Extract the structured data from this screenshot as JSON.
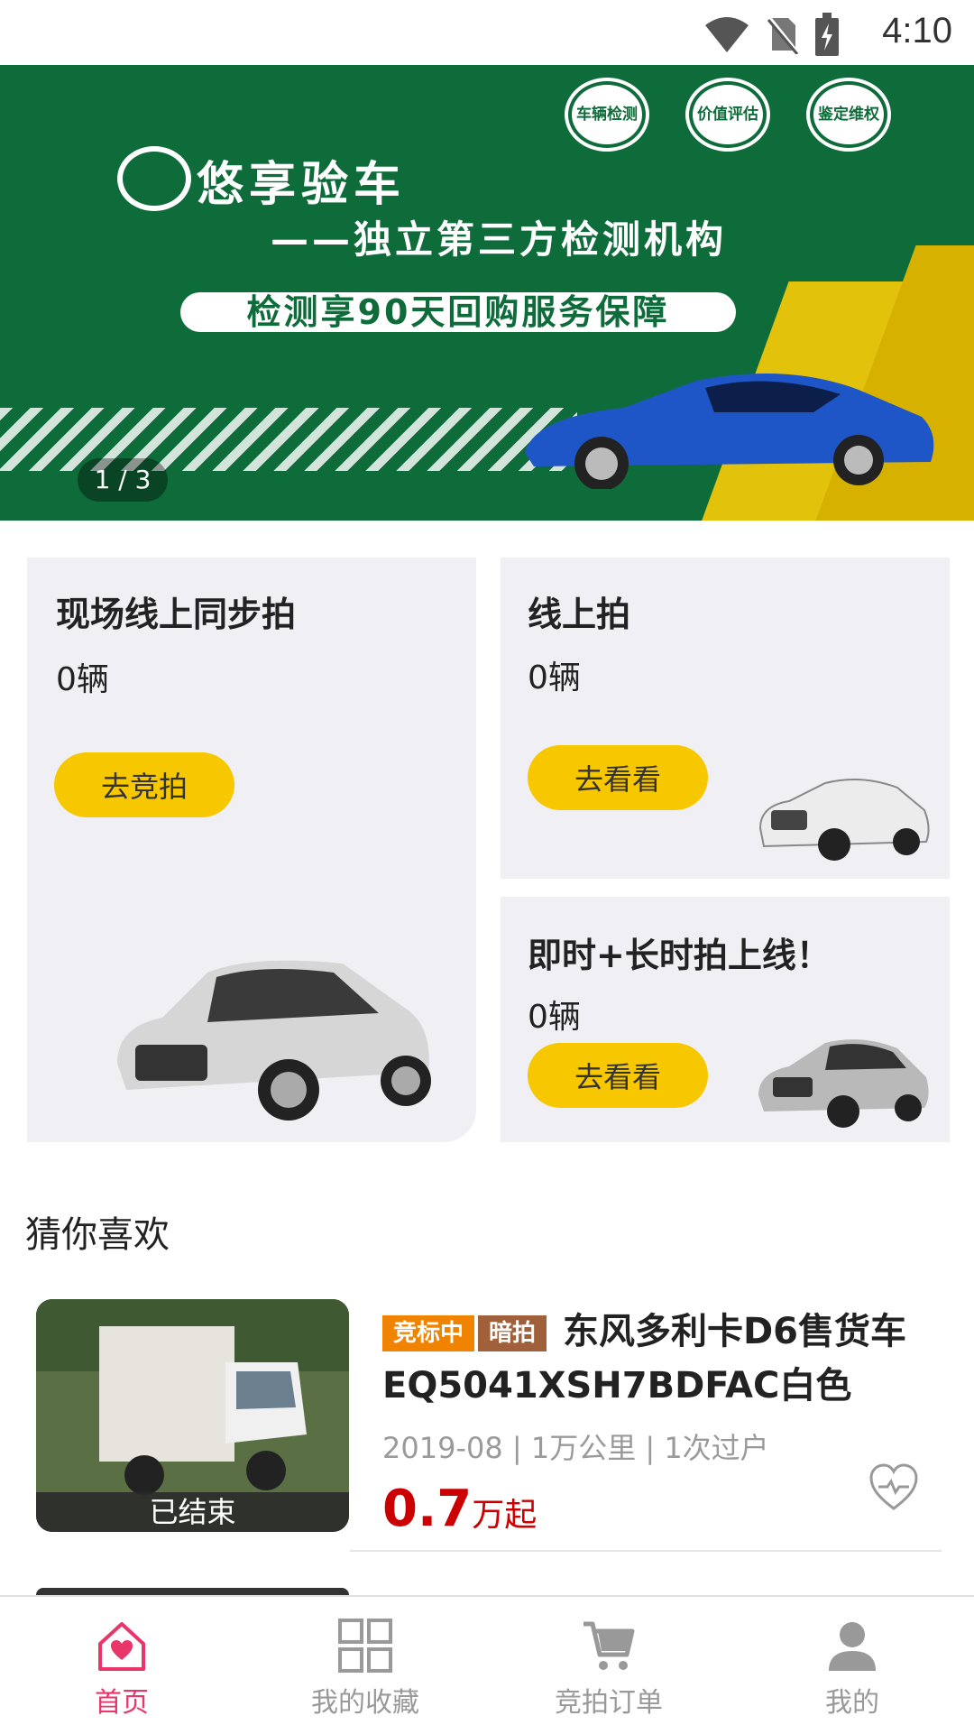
{
  "status_bar": {
    "time": "4:10",
    "icons": [
      "wifi-icon",
      "no-sim-icon",
      "battery-charging-icon"
    ]
  },
  "banner": {
    "logo_text": "悠享验车",
    "subtitle": "——独立第三方检测机构",
    "pill": "检测享90天回购服务保障",
    "badges": [
      "车辆检测",
      "价值评估",
      "鉴定维权"
    ],
    "indicator": "1 / 3",
    "colors": {
      "green": "#0e6b3a",
      "yellow": "#e2c20a"
    }
  },
  "cards": {
    "live_sync": {
      "title": "现场线上同步拍",
      "count": "0辆",
      "button": "去竞拍"
    },
    "online": {
      "title": "线上拍",
      "count": "0辆",
      "button": "去看看"
    },
    "instant_long": {
      "title": "即时+长时拍上线！",
      "count": "0辆",
      "button": "去看看"
    }
  },
  "recommend": {
    "title": "猜你喜欢",
    "items": [
      {
        "tags": [
          "竞标中",
          "暗拍"
        ],
        "tag_colors": [
          "#f08300",
          "#a0603a"
        ],
        "title": "东风多利卡D6售货车EQ5041XSH7BDFAC白色",
        "meta": "2019-08 | 1万公里 | 1次过户",
        "price": "0.7",
        "price_unit": "万起",
        "status": "已结束",
        "favorite_icon": "heart-outline-icon"
      }
    ]
  },
  "bottom_nav": {
    "active_color": "#e8356a",
    "inactive_color": "#999999",
    "items": [
      {
        "label": "首页",
        "icon": "home-heart-icon",
        "active": true
      },
      {
        "label": "我的收藏",
        "icon": "grid-icon",
        "active": false
      },
      {
        "label": "竞拍订单",
        "icon": "cart-icon",
        "active": false
      },
      {
        "label": "我的",
        "icon": "user-icon",
        "active": false
      }
    ]
  }
}
